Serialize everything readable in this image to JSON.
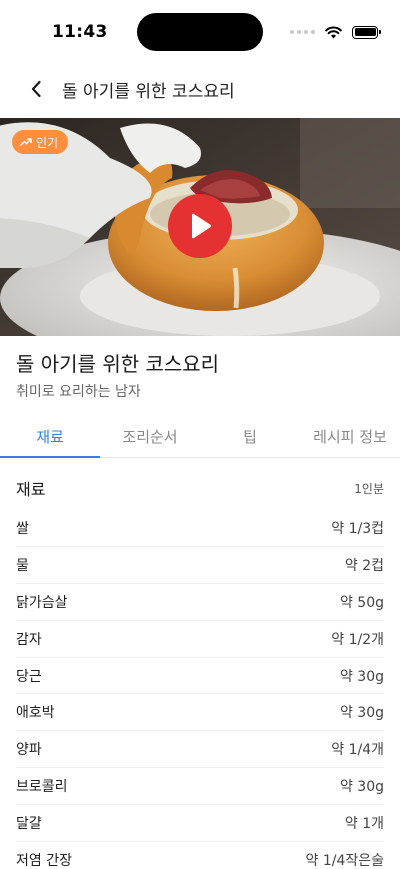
{
  "status_bar": {
    "time": "11:43"
  },
  "header": {
    "title": "돌 아기를 위한 코스요리",
    "back_icon": "chevron-left-icon"
  },
  "media": {
    "badge": "인기",
    "badge_icon": "trending-up-icon",
    "badge_color": "#ff8f3f",
    "play_icon": "play-icon",
    "play_color": "#e53131"
  },
  "recipe": {
    "title": "돌 아기를 위한 코스요리",
    "author": "취미로 요리하는 남자"
  },
  "tabs": [
    {
      "label": "재료",
      "active": true
    },
    {
      "label": "조리순서",
      "active": false
    },
    {
      "label": "팁",
      "active": false
    },
    {
      "label": "레시피 정보",
      "active": false
    }
  ],
  "accent_color": "#2f80ed",
  "ingredients": {
    "title": "재료",
    "serving": "1인분",
    "items": [
      {
        "name": "쌀",
        "amount": "약 1/3컵"
      },
      {
        "name": "물",
        "amount": "약 2컵"
      },
      {
        "name": "닭가슴살",
        "amount": "약 50g"
      },
      {
        "name": "감자",
        "amount": "약 1/2개"
      },
      {
        "name": "당근",
        "amount": "약 30g"
      },
      {
        "name": "애호박",
        "amount": "약 30g"
      },
      {
        "name": "양파",
        "amount": "약 1/4개"
      },
      {
        "name": "브로콜리",
        "amount": "약 30g"
      },
      {
        "name": "달걀",
        "amount": "약 1개"
      },
      {
        "name": "저염 간장",
        "amount": "약 1/4작은술"
      }
    ]
  }
}
